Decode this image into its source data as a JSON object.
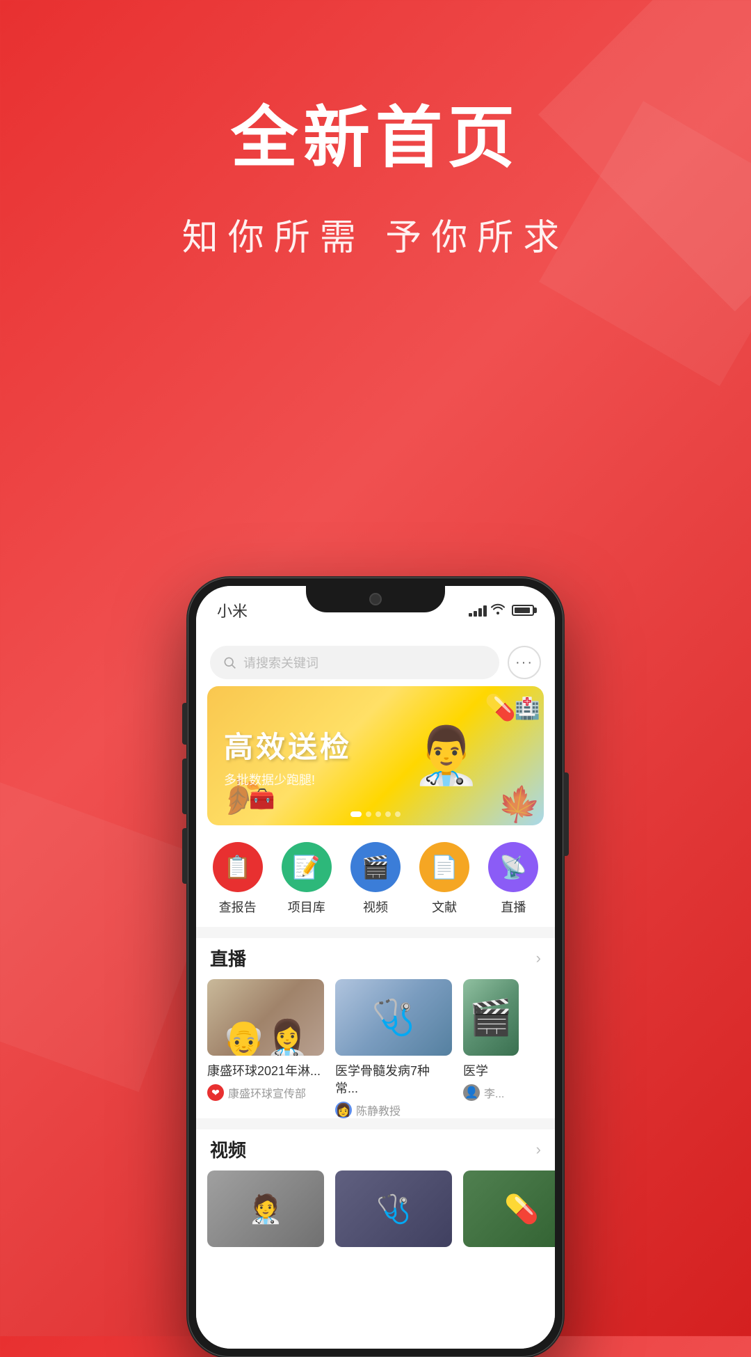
{
  "background": {
    "gradient_start": "#e83030",
    "gradient_end": "#d42020"
  },
  "hero": {
    "title": "全新首页",
    "subtitle": "知你所需  予你所求"
  },
  "phone": {
    "carrier": "小米",
    "signal_level": 4,
    "battery_percent": 80
  },
  "search": {
    "placeholder": "请搜索关键词",
    "more_button_label": "···"
  },
  "banner": {
    "title": "高效送检",
    "subtitle": "多批数据少跑腿!",
    "dots": [
      true,
      false,
      false,
      false,
      false
    ]
  },
  "quick_access": {
    "items": [
      {
        "id": "report",
        "label": "查报告",
        "color": "#e83030",
        "icon": "📋"
      },
      {
        "id": "project",
        "label": "项目库",
        "color": "#2db87a",
        "icon": "📝"
      },
      {
        "id": "video",
        "label": "视频",
        "color": "#3b7dd8",
        "icon": "🎬"
      },
      {
        "id": "literature",
        "label": "文献",
        "color": "#f5a623",
        "icon": "📄"
      },
      {
        "id": "live",
        "label": "直播",
        "color": "#8b5cf6",
        "icon": "📡"
      }
    ]
  },
  "live_section": {
    "title": "直播",
    "more_label": ">",
    "cards": [
      {
        "id": "live1",
        "title": "康盛环球2021年淋...",
        "author_name": "康盛环球宣传部",
        "author_icon": "❤️",
        "thumb_type": "people"
      },
      {
        "id": "live2",
        "title": "医学骨髓发病7种常...",
        "author_name": "陈静教授",
        "author_icon": "👩",
        "thumb_type": "medical"
      },
      {
        "id": "live3",
        "title": "医学",
        "author_name": "李...",
        "author_icon": "👤",
        "thumb_type": "video"
      }
    ]
  },
  "video_section": {
    "title": "视频",
    "more_label": ">",
    "cards": [
      {
        "id": "vid1",
        "thumb_type": "blur1"
      },
      {
        "id": "vid2",
        "thumb_type": "blur2"
      },
      {
        "id": "vid3",
        "thumb_type": "blur3"
      }
    ]
  }
}
